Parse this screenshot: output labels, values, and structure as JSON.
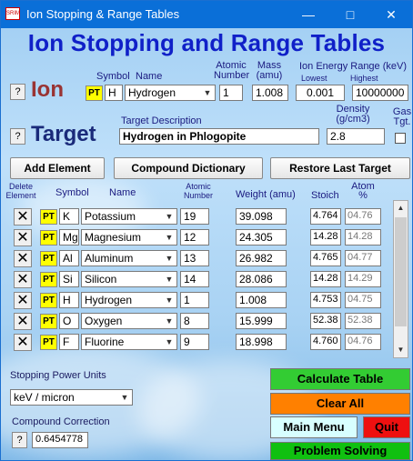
{
  "window": {
    "title": "Ion Stopping & Range Tables",
    "minimize_icon": "minimize-icon",
    "maximize_icon": "maximize-icon",
    "close_icon": "close-icon"
  },
  "heading": "Ion Stopping and Range Tables",
  "ion": {
    "label": "Ion",
    "help": "?",
    "symbol_header": "Symbol",
    "name_header": "Name",
    "atomic_number_header": [
      "Atomic",
      "Number"
    ],
    "mass_header": [
      "Mass",
      "(amu)"
    ],
    "energy_header": "Ion Energy Range (keV)",
    "lowest_header": "Lowest",
    "highest_header": "Highest",
    "pt": "PT",
    "symbol": "H",
    "name": "Hydrogen",
    "atomic_number": "1",
    "mass": "1.008",
    "lowest": "0.001",
    "highest": "10000000"
  },
  "target": {
    "label": "Target",
    "help": "?",
    "description_header": "Target Description",
    "density_header": [
      "Density",
      "(g/cm3)"
    ],
    "gas_header": [
      "Gas",
      "Tgt."
    ],
    "description": "Hydrogen in Phlogopite",
    "density": "2.8"
  },
  "buttons": {
    "add_element": "Add Element",
    "compound_dictionary": "Compound Dictionary",
    "restore_last_target": "Restore Last Target"
  },
  "element_headers": {
    "delete": [
      "Delete",
      "Element"
    ],
    "symbol": "Symbol",
    "name": "Name",
    "atomic_number": [
      "Atomic",
      "Number"
    ],
    "weight": "Weight (amu)",
    "stoich": "Stoich",
    "atom_pct": [
      "Atom",
      "%"
    ]
  },
  "elements": [
    {
      "x": "✕",
      "pt": "PT",
      "symbol": "K",
      "name": "Potassium",
      "z": "19",
      "weight": "39.098",
      "stoich": "4.764",
      "atom": "04.76"
    },
    {
      "x": "✕",
      "pt": "PT",
      "symbol": "Mg",
      "name": "Magnesium",
      "z": "12",
      "weight": "24.305",
      "stoich": "14.28",
      "atom": "14.28"
    },
    {
      "x": "✕",
      "pt": "PT",
      "symbol": "Al",
      "name": "Aluminum",
      "z": "13",
      "weight": "26.982",
      "stoich": "4.765",
      "atom": "04.77"
    },
    {
      "x": "✕",
      "pt": "PT",
      "symbol": "Si",
      "name": "Silicon",
      "z": "14",
      "weight": "28.086",
      "stoich": "14.28",
      "atom": "14.29"
    },
    {
      "x": "✕",
      "pt": "PT",
      "symbol": "H",
      "name": "Hydrogen",
      "z": "1",
      "weight": "1.008",
      "stoich": "4.753",
      "atom": "04.75"
    },
    {
      "x": "✕",
      "pt": "PT",
      "symbol": "O",
      "name": "Oxygen",
      "z": "8",
      "weight": "15.999",
      "stoich": "52.38",
      "atom": "52.38"
    },
    {
      "x": "✕",
      "pt": "PT",
      "symbol": "F",
      "name": "Fluorine",
      "z": "9",
      "weight": "18.998",
      "stoich": "4.760",
      "atom": "04.76"
    }
  ],
  "stopping": {
    "label": "Stopping Power Units",
    "value": "keV / micron"
  },
  "compound_correction": {
    "label": "Compound Correction",
    "help": "?",
    "value": "0.6454778"
  },
  "actions": {
    "calculate": "Calculate Table",
    "clear_all": "Clear All",
    "main_menu": "Main Menu",
    "quit": "Quit",
    "problem_solving": "Problem Solving"
  },
  "colors": {
    "title_blue": "#1020c8",
    "ion_red": "#993333",
    "target_navy": "#1a2a7a",
    "calc_green": "#33cc33",
    "clear_orange": "#ff8000",
    "quit_red": "#ee1010",
    "menu_cyan": "#d8ffff",
    "problem_green": "#10c010"
  }
}
